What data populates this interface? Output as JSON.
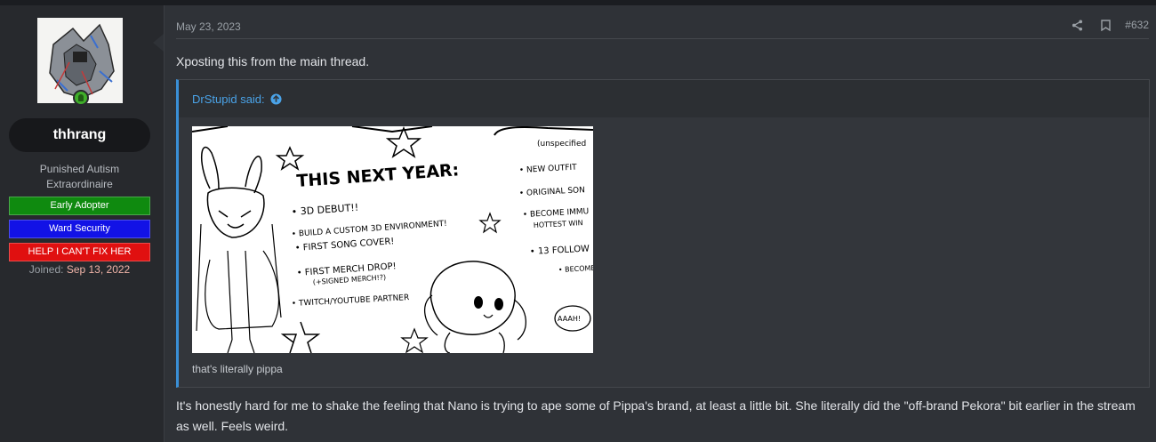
{
  "user": {
    "username": "thhrang",
    "title_line1": "Punished Autism",
    "title_line2": "Extraordinaire",
    "banners": [
      "Early Adopter",
      "Ward Security",
      "HELP I CAN'T FIX HER"
    ],
    "joined_label": "Joined:",
    "joined_date": "Sep 13, 2022",
    "online": true
  },
  "post": {
    "date": "May 23, 2023",
    "number": "#632",
    "intro": "Xposting this from the main thread.",
    "quote": {
      "author": "DrStupid said:",
      "caption": "that's literally pippa",
      "image_text": {
        "heading": "THIS NEXT YEAR:",
        "items": [
          "3D DEBUT!!",
          "BUILD A CUSTOM 3D ENVIRONMENT!",
          "FIRST SONG COVER!",
          "FIRST MERCH DROP!",
          "(+SIGNED MERCH!?)",
          "TWITCH/YOUTUBE PARTNER"
        ],
        "right_items": [
          "NEW OUTFIT",
          "ORIGINAL SON",
          "BECOME IMMU",
          "HOTTEST WIN",
          "13 FOLLOW",
          "BECOME"
        ],
        "corner": "(unspecified",
        "speech": "AAAH!"
      }
    },
    "body": "It's honestly hard for me to shake the feeling that Nano is trying to ape some of Pippa's brand, at least a little bit. She literally did the \"off-brand Pekora\" bit earlier in the stream as well. Feels weird."
  },
  "colors": {
    "link": "#4aa3e8",
    "green_banner": "#0f8a0f",
    "blue_banner": "#1212e6",
    "red_banner": "#e01010",
    "joined_date": "#f0b4a8"
  },
  "icons": {
    "share": "share-icon",
    "bookmark": "bookmark-icon",
    "quote_up": "arrow-up-circle-icon",
    "online": "online-status-icon"
  }
}
